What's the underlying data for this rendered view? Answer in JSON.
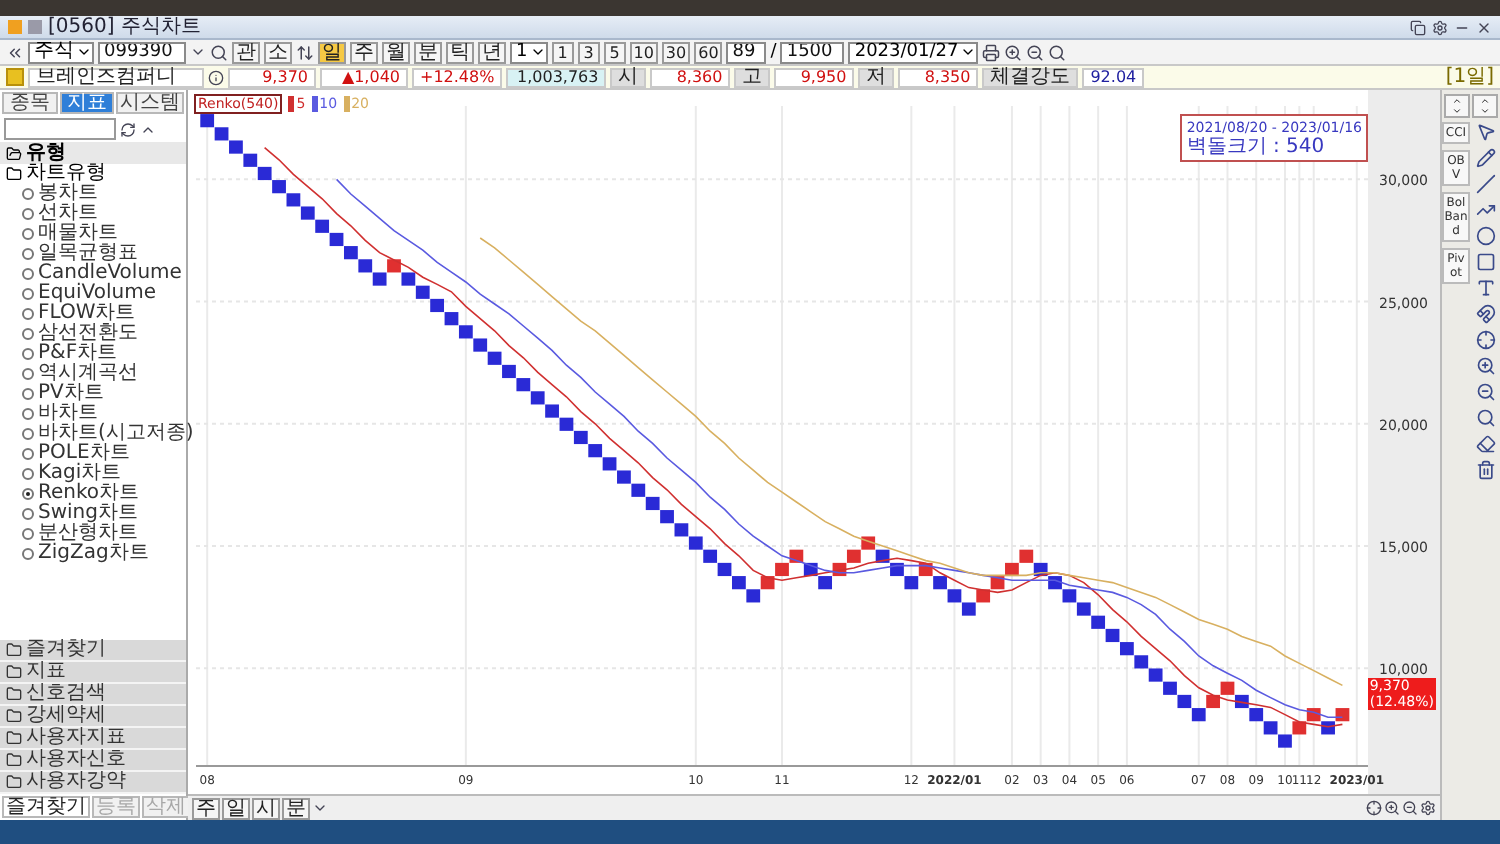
{
  "window": {
    "title": "[0560] 주식차트"
  },
  "toolbar": {
    "market": "주식",
    "code": "099390",
    "buttons": [
      "관",
      "소"
    ],
    "periods": [
      {
        "label": "일",
        "selected": true
      },
      {
        "label": "주",
        "selected": false
      },
      {
        "label": "월",
        "selected": false
      },
      {
        "label": "분",
        "selected": false
      },
      {
        "label": "틱",
        "selected": false
      },
      {
        "label": "년",
        "selected": false
      }
    ],
    "interval": "1",
    "intervals": [
      "1",
      "3",
      "5",
      "10",
      "30",
      "60"
    ],
    "count": "89",
    "separator": "/",
    "total": "1500",
    "date": "2023/01/27"
  },
  "quote": {
    "name": "브레인즈컴퍼니",
    "price": "9,370",
    "change": "▲1,040",
    "change_rate": "+12.48%",
    "volume": "1,003,763",
    "fields": [
      {
        "label": "시",
        "value": "8,360"
      },
      {
        "label": "고",
        "value": "9,950"
      },
      {
        "label": "저",
        "value": "8,350"
      }
    ],
    "strength_label": "체결강도",
    "strength": "92.04",
    "period_tag": "[1일]"
  },
  "sidebar": {
    "tabs": [
      {
        "label": "종목",
        "selected": false
      },
      {
        "label": "지표",
        "selected": true
      },
      {
        "label": "시스템",
        "selected": false
      }
    ],
    "tree": [
      {
        "label": "유형",
        "kind": "group"
      },
      {
        "label": "차트유형",
        "kind": "category",
        "children": [
          {
            "label": "봉차트",
            "selected": false
          },
          {
            "label": "선차트",
            "selected": false
          },
          {
            "label": "매물차트",
            "selected": false
          },
          {
            "label": "일목균형표",
            "selected": false
          },
          {
            "label": "CandleVolume",
            "selected": false
          },
          {
            "label": "EquiVolume",
            "selected": false
          },
          {
            "label": "FLOW차트",
            "selected": false
          },
          {
            "label": "삼선전환도",
            "selected": false
          },
          {
            "label": "P&F차트",
            "selected": false
          },
          {
            "label": "역시계곡선",
            "selected": false
          },
          {
            "label": "PV차트",
            "selected": false
          },
          {
            "label": "바차트",
            "selected": false
          },
          {
            "label": "바차트(시고저종)",
            "selected": false
          },
          {
            "label": "POLE차트",
            "selected": false
          },
          {
            "label": "Kagi차트",
            "selected": false
          },
          {
            "label": "Renko차트",
            "selected": true
          },
          {
            "label": "Swing차트",
            "selected": false
          },
          {
            "label": "분산형차트",
            "selected": false
          },
          {
            "label": "ZigZag차트",
            "selected": false
          }
        ]
      }
    ],
    "folders": [
      "즐겨찾기",
      "지표",
      "신호검색",
      "강세약세",
      "사용자지표",
      "사용자신호",
      "사용자강약"
    ],
    "bottom_tabs": [
      {
        "label": "즐겨찾기",
        "selected": true,
        "disabled": false
      },
      {
        "label": "등록",
        "selected": false,
        "disabled": true
      },
      {
        "label": "삭제",
        "selected": false,
        "disabled": true
      }
    ]
  },
  "chart": {
    "range": "2021/08/20 - 2023/01/16",
    "brick_label": "벽돌크기 : 540",
    "last_price": "9,370",
    "last_rate": "(12.48%)",
    "chart_data": {
      "type": "scatter",
      "grid": true,
      "ylim": [
        6000,
        33000
      ],
      "yticks": [
        {
          "value": 10000,
          "label": "10,000"
        },
        {
          "value": 15000,
          "label": "15,000"
        },
        {
          "value": 20000,
          "label": "20,000"
        },
        {
          "value": 25000,
          "label": "25,000"
        },
        {
          "value": 30000,
          "label": "30,000"
        }
      ],
      "categories": [
        "08",
        null,
        null,
        null,
        null,
        null,
        null,
        null,
        null,
        null,
        null,
        null,
        null,
        null,
        null,
        null,
        null,
        null,
        "09",
        null,
        null,
        null,
        null,
        null,
        null,
        null,
        null,
        null,
        null,
        null,
        null,
        null,
        null,
        null,
        "10",
        null,
        null,
        null,
        null,
        null,
        "11",
        null,
        null,
        null,
        null,
        null,
        null,
        null,
        null,
        "12",
        null,
        null,
        "2022/01",
        null,
        null,
        null,
        "02",
        null,
        "03",
        null,
        "04",
        null,
        "05",
        null,
        "06",
        null,
        null,
        null,
        null,
        "07",
        null,
        "08",
        null,
        "09",
        null,
        "10",
        "11",
        "12",
        null,
        null,
        "2023/01"
      ],
      "series": [
        {
          "name": "Renko(540)",
          "color": "#2a2ad6",
          "values": [
            32400,
            31860,
            31320,
            30780,
            30240,
            29700,
            29160,
            28620,
            28080,
            27540,
            27000,
            26460,
            25920,
            null,
            25920,
            25380,
            24840,
            24300,
            23760,
            23220,
            22680,
            22140,
            21600,
            21060,
            20520,
            19980,
            19440,
            18900,
            18360,
            17820,
            17280,
            16740,
            16200,
            15660,
            15120,
            14580,
            14040,
            13500,
            12960,
            null,
            null,
            null,
            14040,
            13500,
            null,
            null,
            null,
            14580,
            14040,
            13500,
            null,
            13500,
            12960,
            12420,
            null,
            null,
            null,
            null,
            14040,
            13500,
            12960,
            12420,
            11880,
            11340,
            10800,
            10260,
            9720,
            9180,
            8640,
            8100,
            null,
            null,
            8640,
            8100,
            7560,
            7020,
            null,
            null,
            7560,
            null,
            null
          ]
        },
        {
          "color": "#e03030",
          "values": [
            null,
            null,
            null,
            null,
            null,
            null,
            null,
            null,
            null,
            null,
            null,
            null,
            null,
            26460,
            null,
            null,
            null,
            null,
            null,
            null,
            null,
            null,
            null,
            null,
            null,
            null,
            null,
            null,
            null,
            null,
            null,
            null,
            null,
            null,
            null,
            null,
            null,
            null,
            null,
            13500,
            14040,
            14580,
            null,
            null,
            14040,
            14580,
            15120,
            null,
            null,
            null,
            14040,
            null,
            null,
            null,
            12960,
            13500,
            14040,
            14580,
            null,
            null,
            null,
            null,
            null,
            null,
            null,
            null,
            null,
            null,
            null,
            null,
            8640,
            9180,
            null,
            null,
            null,
            null,
            7560,
            8100,
            null,
            8100,
            null
          ]
        },
        {
          "name": "5",
          "type": "line",
          "color": "#d03030",
          "values": [
            null,
            null,
            null,
            null,
            31300,
            30800,
            30200,
            29700,
            29200,
            28600,
            28100,
            27500,
            27000,
            26700,
            26400,
            26000,
            25700,
            25400,
            24800,
            24300,
            23800,
            23200,
            22700,
            22100,
            21600,
            21100,
            20500,
            20000,
            19400,
            18900,
            18400,
            17800,
            17300,
            16700,
            16200,
            15700,
            15100,
            14600,
            14000,
            13700,
            13600,
            13700,
            13800,
            13900,
            14000,
            14100,
            14300,
            14400,
            14500,
            14400,
            14300,
            13900,
            13600,
            13300,
            13200,
            13100,
            13200,
            13500,
            13800,
            13900,
            13800,
            13500,
            13000,
            12400,
            11900,
            11300,
            10800,
            10300,
            9700,
            9200,
            8900,
            8700,
            8600,
            8500,
            8400,
            8100,
            7800,
            7700,
            7600,
            7700,
            null
          ]
        },
        {
          "name": "10",
          "type": "line",
          "color": "#5a5ae0",
          "values": [
            null,
            null,
            null,
            null,
            null,
            null,
            null,
            null,
            null,
            30000,
            29400,
            28900,
            28400,
            27900,
            27500,
            27100,
            26600,
            26200,
            25800,
            25300,
            24900,
            24500,
            24000,
            23500,
            23000,
            22400,
            21900,
            21300,
            20800,
            20300,
            19700,
            19200,
            18600,
            18100,
            17600,
            17000,
            16500,
            15900,
            15400,
            15000,
            14600,
            14400,
            14200,
            14000,
            13900,
            13900,
            14000,
            14100,
            14200,
            14200,
            14200,
            14100,
            14000,
            13900,
            13800,
            13700,
            13600,
            13600,
            13600,
            13600,
            13400,
            13300,
            13200,
            13100,
            12900,
            12600,
            12200,
            11600,
            11100,
            10500,
            10100,
            9800,
            9500,
            9100,
            8800,
            8500,
            8300,
            8200,
            8000,
            8000,
            null
          ]
        },
        {
          "name": "20",
          "type": "line",
          "color": "#d8b060",
          "values": [
            null,
            null,
            null,
            null,
            null,
            null,
            null,
            null,
            null,
            null,
            null,
            null,
            null,
            null,
            null,
            null,
            null,
            null,
            null,
            27600,
            27200,
            26700,
            26200,
            25700,
            25200,
            24700,
            24200,
            23800,
            23300,
            22800,
            22300,
            21800,
            21300,
            20800,
            20300,
            19700,
            19200,
            18600,
            18100,
            17600,
            17200,
            16800,
            16400,
            16000,
            15700,
            15400,
            15200,
            15000,
            14800,
            14600,
            14400,
            14300,
            14100,
            13900,
            13800,
            13800,
            13800,
            13800,
            13900,
            13900,
            13800,
            13700,
            13600,
            13500,
            13300,
            13100,
            12900,
            12600,
            12300,
            12000,
            11800,
            11600,
            11300,
            11100,
            10900,
            10500,
            10200,
            9900,
            9600,
            9300,
            null
          ]
        }
      ]
    }
  },
  "chart_footer": {
    "scale_buttons": [
      "주",
      "일",
      "시",
      "분"
    ]
  },
  "right_toolbar": {
    "indicators": [
      "CCI",
      "OBV",
      "Bol Band",
      "Pivot"
    ]
  }
}
